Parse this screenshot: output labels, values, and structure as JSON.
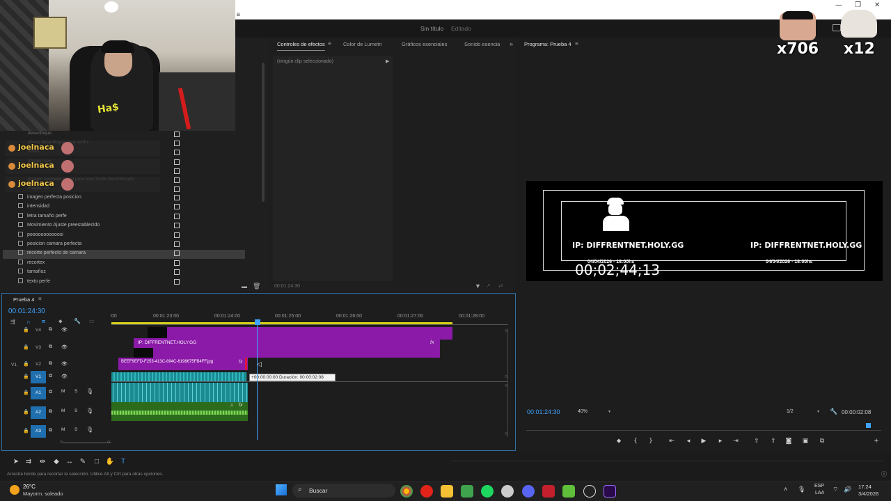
{
  "window": {
    "title_fragment": "a",
    "doc_title": "Sin título",
    "doc_state": "Editado"
  },
  "overlay": {
    "badge1": "x706",
    "badge2": "x12",
    "chat_username": "joelnaca"
  },
  "effects_panel": {
    "tabs": [
      "Controles de efectos",
      "Color de Lumetri",
      "Gráficos esenciales",
      "Sonido esencia"
    ],
    "no_clip": "(ningún clip seleccionado)",
    "timecode": "00:01:24:30"
  },
  "program_monitor": {
    "title": "Programa: Prueba 4",
    "timecode": "00:01:24:30",
    "zoom": "40%",
    "resolution": "1/2",
    "duration": "00:00:02:08",
    "overlay_timecode": "00;02;44;13",
    "ip_left": "IP: DIFFRENTNET.HOLY.GG",
    "ip_right": "IP: DIFFRENTNET.HOLY.GG",
    "date_left": "04/04/2026 - 18:00hs",
    "date_right": "04/04/2026 - 18:00hs"
  },
  "project": {
    "ghost_items": [
      "desenfoque",
      "efecto desenfoque para verif x",
      "fondo",
      "imagen cen",
      "imagen centrada abajo para usar fondo desenfocado",
      "imagen ce"
    ],
    "items": [
      "imagen perfecta posicion",
      "intensidad",
      "letra tamaño perfe",
      "Movimiento Ajuste preestablecido",
      "pooooooooooosi",
      "posicion camara perfecta",
      "recorte perfecto de camara",
      "recortex",
      "tamañoz",
      "texto perfe"
    ],
    "selected_index": 6
  },
  "timeline": {
    "sequence": "Prueba 4",
    "timecode": "00:01:24:30",
    "ruler": [
      ":00",
      "00:01:23:00",
      "00:01:24:00",
      "00:01:25:00",
      "00:01:26:00",
      "00:01:27:00",
      "00:01:28:00"
    ],
    "tracks": {
      "v4": "V4",
      "v3": "V3",
      "v2": "V2",
      "v1": "V1",
      "a1": "A1",
      "a2": "A2",
      "a3": "A3",
      "src_v1": "V1"
    },
    "clip_ip": "IP: DIFFRENTNET.HOLY.GG",
    "clip_jpg": "BEEF9EFD-F253-413C-894C-6198675FB4FF.jpg",
    "tooltip": "+00:00:00:00 Duración: 00:00:02:08",
    "fx": "fx",
    "m": "M",
    "s": "S"
  },
  "status": {
    "hint": "Arrastre borde para recortar la selección. Utilice Alt y Ctrl para otras opciones."
  },
  "taskbar": {
    "weather_temp": "26°C",
    "weather_desc": "Mayorm. soleado",
    "search": "Buscar",
    "lang": "ESP",
    "lang2": "LAA",
    "time": "17:24",
    "date": "3/4/2026"
  },
  "colors": {
    "accent_blue": "#3fa3ff",
    "clip_purple": "#8b1aa8",
    "audio_teal": "#1b8a91",
    "audio_green": "#4a9b2a",
    "ruler_yellow": "#d7d01a"
  }
}
